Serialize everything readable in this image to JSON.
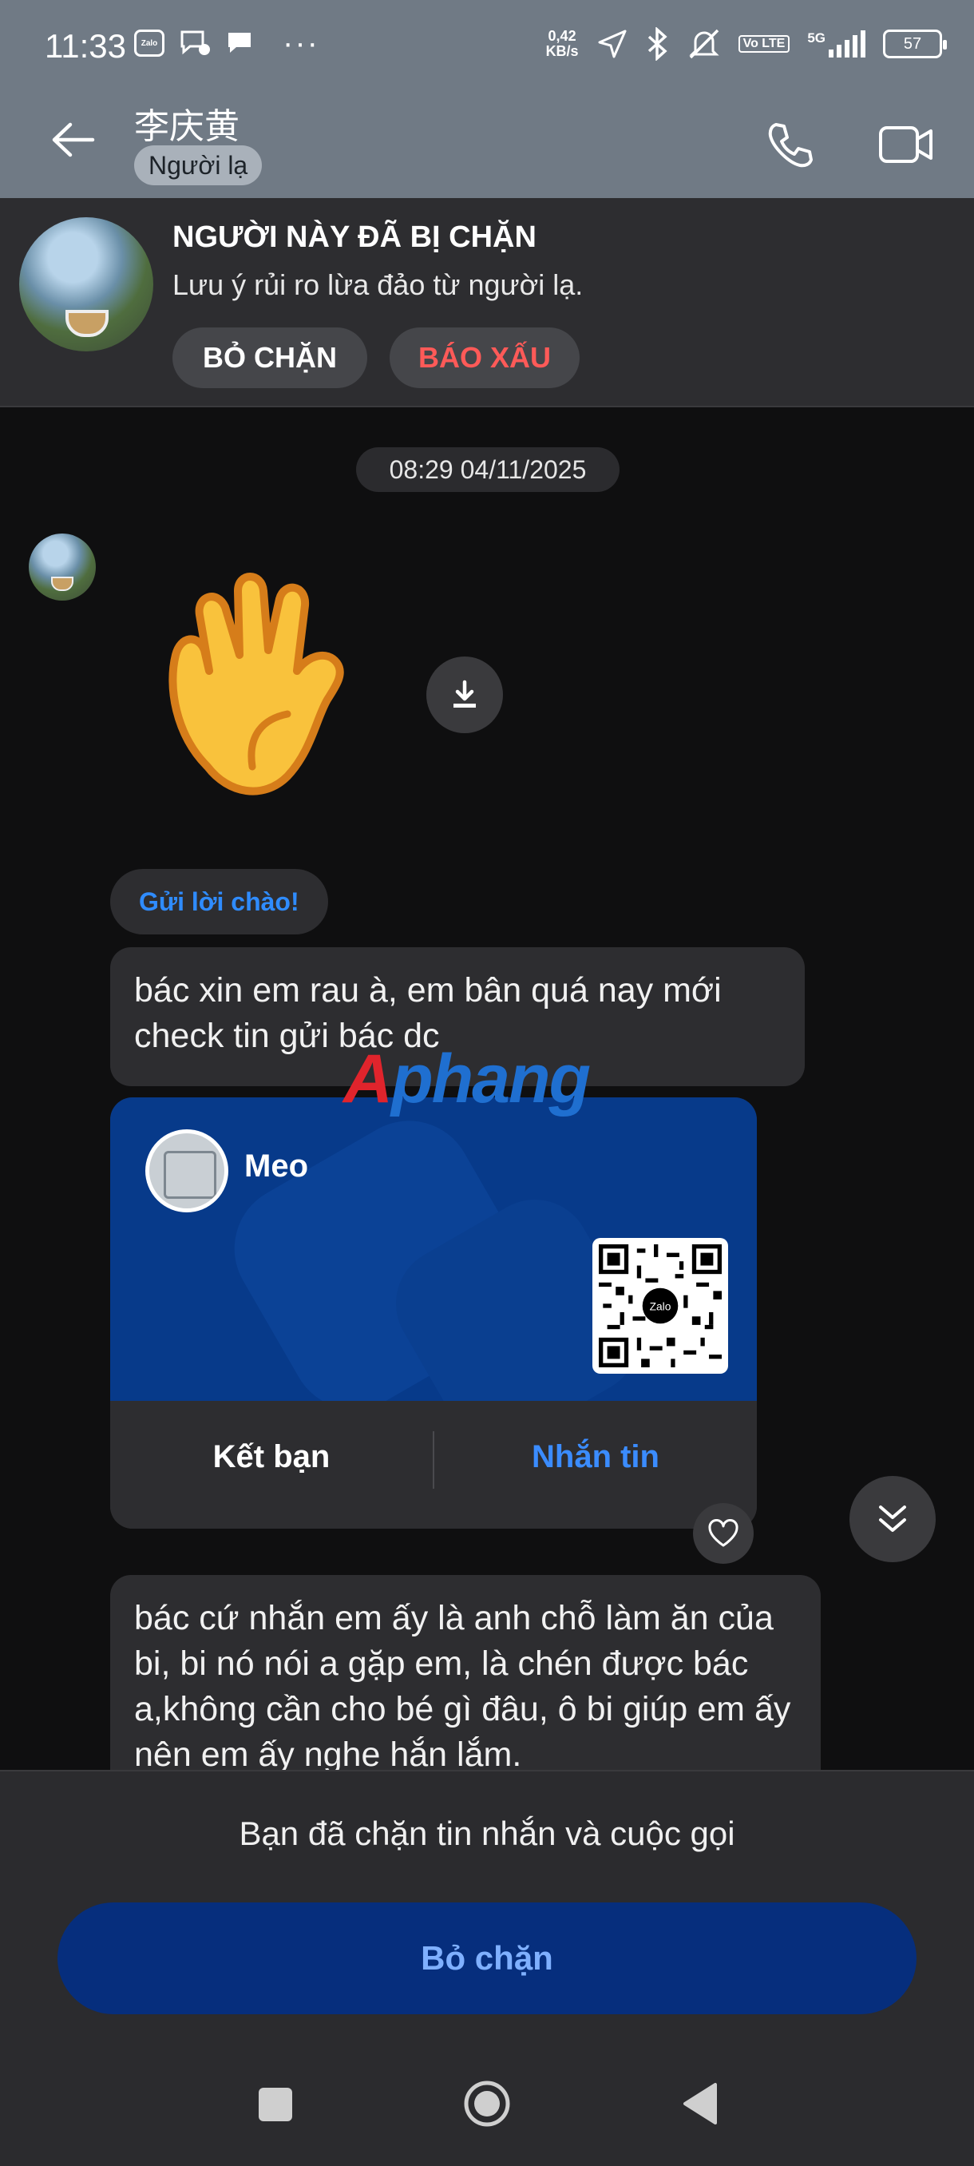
{
  "status_bar": {
    "time": "11:33",
    "app_badge": "Zalo",
    "more": "···",
    "net_speed_top": "0,42",
    "net_speed_bottom": "KB/s",
    "volte": "Vo LTE",
    "network": "5G",
    "battery": "57",
    "icons": [
      "zalo-icon",
      "chat-bubble-icon",
      "message-icon",
      "location-icon",
      "bluetooth-icon",
      "mute-icon",
      "signal-icon",
      "battery-icon"
    ]
  },
  "header": {
    "contact_name": "李庆黄",
    "stranger_label": "Người lạ",
    "icons": [
      "back-arrow-icon",
      "phone-icon",
      "video-icon"
    ]
  },
  "blocked_banner": {
    "title": "NGƯỜI NÀY ĐÃ BỊ CHẶN",
    "subtitle": "Lưu ý rủi ro lừa đảo từ người lạ.",
    "unblock_label": "BỎ CHẶN",
    "report_label": "BÁO XẤU",
    "colors": {
      "report": "#ff5a58"
    }
  },
  "chat": {
    "date": "08:29 04/11/2025",
    "greet_chip": "Gửi lời chào!",
    "message_1": "bác xin em rau à, em bân quá nay mới check tin gửi bác dc",
    "contact_card": {
      "name": "Meo",
      "qr_label": "Zalo",
      "add_friend_label": "Kết bạn",
      "message_label": "Nhắn tin"
    },
    "message_2": "bác cứ nhắn em ấy là anh chỗ làm ăn của bi, bi nó nói a gặp em, là chén được bác a,không cần cho bé gì đâu,  ô bi giúp em ấy nên em ấy nghe hắn lắm.",
    "watermark_part1": "A",
    "watermark_part2": "phang"
  },
  "bottom_panel": {
    "notice": "Bạn đã chặn tin nhắn và cuộc gọi",
    "unblock_button": "Bỏ chặn",
    "colors": {
      "button_bg": "#062e7d",
      "button_text": "#7fb0ff"
    }
  },
  "nav": {
    "icons": [
      "recent-apps-icon",
      "home-icon",
      "back-icon"
    ]
  }
}
